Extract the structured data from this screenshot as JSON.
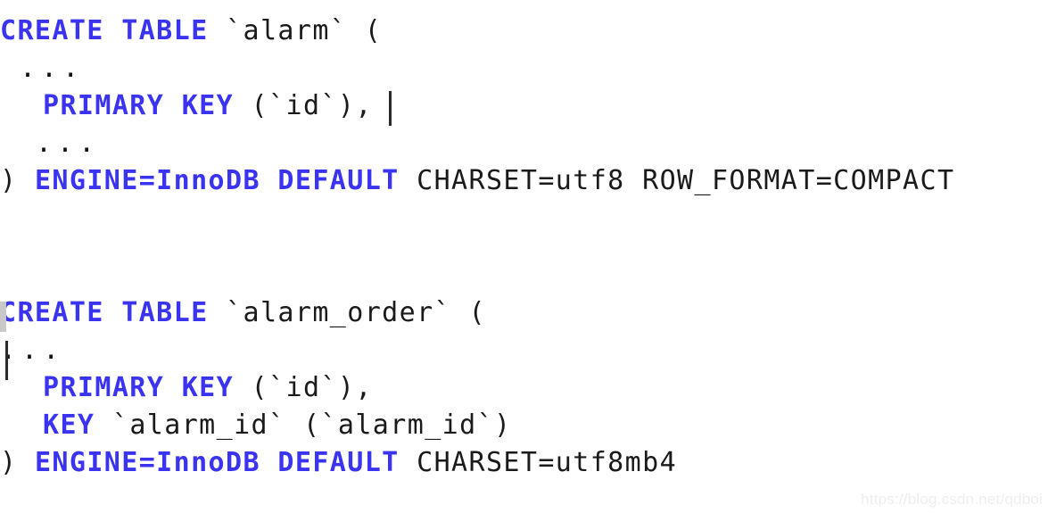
{
  "editor": {
    "background_color": "#ffffff",
    "keyword_color": "#3a33f0",
    "identifier_color": "#1a1a1a",
    "caret_color": "#2b2b2b"
  },
  "blocks": [
    {
      "name": "create-table-alarm",
      "lines": [
        {
          "indent": 0,
          "tokens": [
            {
              "type": "kw",
              "text": "CREATE TABLE"
            },
            {
              "type": "plain",
              "text": " "
            },
            {
              "type": "ident",
              "text": "`alarm`"
            },
            {
              "type": "plain",
              "text": " "
            },
            {
              "type": "punc",
              "text": "("
            }
          ]
        },
        {
          "indent": 1,
          "tokens": [
            {
              "type": "dots",
              "text": "..."
            }
          ]
        },
        {
          "indent": 2,
          "tokens": [
            {
              "type": "kw",
              "text": "PRIMARY KEY"
            },
            {
              "type": "plain",
              "text": " "
            },
            {
              "type": "punc",
              "text": "("
            },
            {
              "type": "ident",
              "text": "`id`"
            },
            {
              "type": "punc",
              "text": "),"
            }
          ]
        },
        {
          "indent": 2,
          "tokens": [
            {
              "type": "dots",
              "text": "..."
            }
          ]
        },
        {
          "indent": 0,
          "tokens": [
            {
              "type": "punc",
              "text": ")"
            },
            {
              "type": "plain",
              "text": " "
            },
            {
              "type": "kw",
              "text": "ENGINE=InnoDB DEFAULT"
            },
            {
              "type": "plain",
              "text": " "
            },
            {
              "type": "ident",
              "text": "CHARSET=utf8 ROW_FORMAT=COMPACT"
            }
          ]
        }
      ]
    },
    {
      "name": "create-table-alarm-order",
      "lines": [
        {
          "indent": 0,
          "tokens": [
            {
              "type": "kw",
              "text": "CREATE TABLE"
            },
            {
              "type": "plain",
              "text": " "
            },
            {
              "type": "ident",
              "text": "`alarm_order`"
            },
            {
              "type": "plain",
              "text": " "
            },
            {
              "type": "punc",
              "text": "("
            }
          ]
        },
        {
          "indent": 0,
          "tokens": [
            {
              "type": "dots",
              "text": "..."
            }
          ]
        },
        {
          "indent": 2,
          "tokens": [
            {
              "type": "kw",
              "text": "PRIMARY KEY"
            },
            {
              "type": "plain",
              "text": " "
            },
            {
              "type": "punc",
              "text": "("
            },
            {
              "type": "ident",
              "text": "`id`"
            },
            {
              "type": "punc",
              "text": "),"
            }
          ]
        },
        {
          "indent": 2,
          "tokens": [
            {
              "type": "kw",
              "text": "KEY"
            },
            {
              "type": "plain",
              "text": " "
            },
            {
              "type": "ident",
              "text": "`alarm_id`"
            },
            {
              "type": "plain",
              "text": " "
            },
            {
              "type": "punc",
              "text": "("
            },
            {
              "type": "ident",
              "text": "`alarm_id`"
            },
            {
              "type": "punc",
              "text": ")"
            }
          ]
        },
        {
          "indent": 0,
          "tokens": [
            {
              "type": "punc",
              "text": ")"
            },
            {
              "type": "plain",
              "text": " "
            },
            {
              "type": "kw",
              "text": "ENGINE=InnoDB DEFAULT"
            },
            {
              "type": "plain",
              "text": " "
            },
            {
              "type": "ident",
              "text": "CHARSET=utf8mb4"
            }
          ]
        }
      ]
    }
  ],
  "carets": [
    {
      "name": "caret-primary-key",
      "after": "PRIMARY KEY (`id`),"
    },
    {
      "name": "caret-alarm-order",
      "after": "line-start"
    }
  ],
  "watermark": {
    "text": "https://blog.csdn.net/qdboi"
  }
}
